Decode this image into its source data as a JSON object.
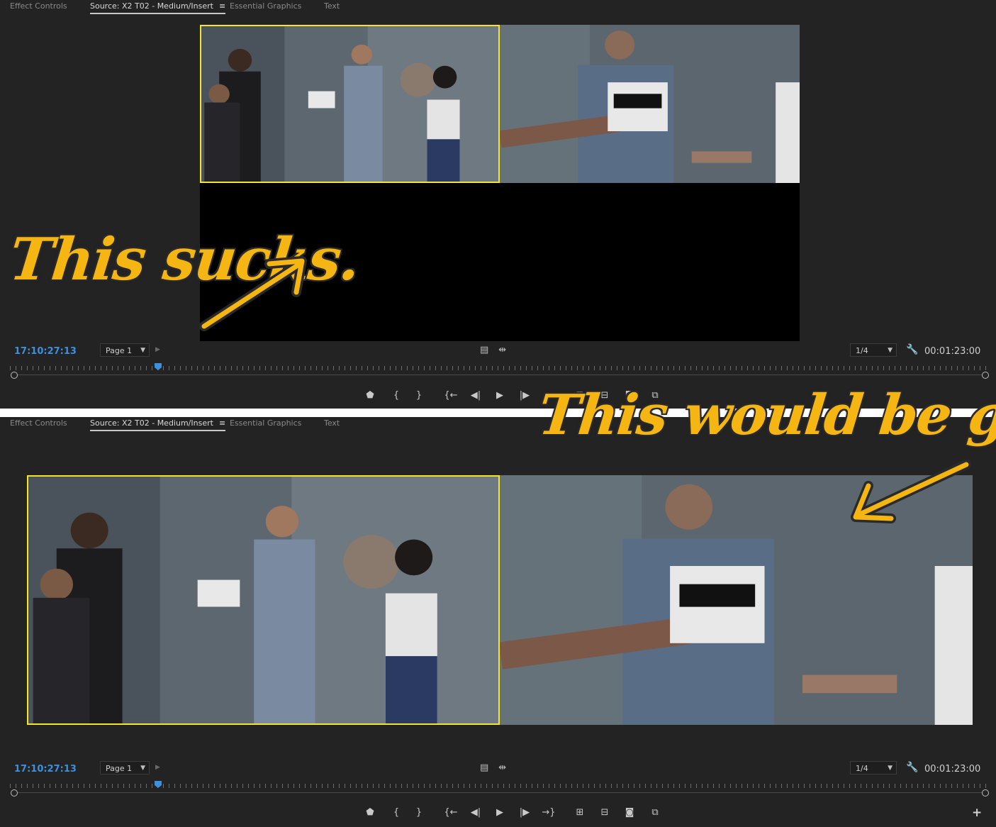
{
  "tabs": [
    {
      "label": "Effect Controls",
      "active": false
    },
    {
      "label": "Source: X2 T02 - Medium/Insert",
      "active": true
    },
    {
      "label": "Essential Graphics",
      "active": false
    },
    {
      "label": "Text",
      "active": false
    }
  ],
  "menu_icon": "≡",
  "status": {
    "timecode": "17:10:27:13",
    "page": "Page 1",
    "zoom": "1/4",
    "duration": "00:01:23:00"
  },
  "annotations": {
    "top": "This sucks.",
    "bottom": "This would be great."
  },
  "colors": {
    "accent_blue": "#3d8fe0",
    "highlight_yellow": "#f4e528",
    "annotation_orange": "#f5b512",
    "panel_bg": "#232323"
  },
  "icons": {
    "top_transport": [
      "marker-icon",
      "mark-in-icon",
      "mark-out-icon",
      "go-to-in-icon",
      "step-back-icon",
      "play-icon",
      "step-forward-icon",
      "insert-icon",
      "overwrite-icon",
      "export-frame-icon",
      "multicam-icon"
    ],
    "bottom_transport": [
      "marker-icon",
      "mark-in-icon",
      "mark-out-icon",
      "go-to-in-icon",
      "step-back-icon",
      "play-icon",
      "step-forward-icon",
      "go-to-out-icon",
      "insert-icon",
      "overwrite-icon",
      "export-frame-icon",
      "multicam-icon",
      "add-button-icon"
    ]
  }
}
